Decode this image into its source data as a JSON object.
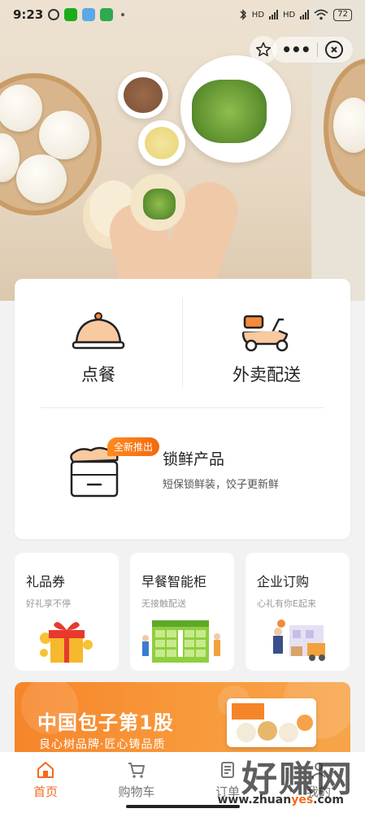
{
  "status_bar": {
    "time": "9:23",
    "battery": "72",
    "net1": "HD",
    "net2": "HD"
  },
  "hero": {
    "star_icon": "star-icon",
    "more_icon": "more-dots-icon",
    "close_icon": "close-circle-icon"
  },
  "services": {
    "dine": {
      "label": "点餐",
      "icon": "food-cloche-icon"
    },
    "delivery": {
      "label": "外卖配送",
      "icon": "scooter-icon"
    },
    "fresh": {
      "badge": "全新推出",
      "title": "锁鲜产品",
      "subtitle": "短保锁鲜装，饺子更新鲜",
      "icon": "fresh-box-icon"
    }
  },
  "tiles": [
    {
      "title": "礼品券",
      "subtitle": "好礼享不停",
      "icon": "gift-box-icon"
    },
    {
      "title": "早餐智能柜",
      "subtitle": "无接触配送",
      "icon": "smart-locker-icon"
    },
    {
      "title": "企业订购",
      "subtitle": "心礼有你E起来",
      "icon": "enterprise-order-icon"
    }
  ],
  "banner": {
    "title": "中国包子第1股",
    "subtitle": "良心树品牌·匠心铸品质"
  },
  "nav": [
    {
      "label": "首页",
      "icon": "home-icon",
      "active": true
    },
    {
      "label": "购物车",
      "icon": "cart-icon",
      "active": false
    },
    {
      "label": "订单",
      "icon": "order-icon",
      "active": false
    },
    {
      "label": "我的",
      "icon": "profile-icon",
      "active": false
    }
  ],
  "watermark": {
    "text": "好赚网",
    "url_pre": "www.zhuan",
    "url_hl": "yes",
    "url_post": ".com"
  },
  "colors": {
    "accent": "#f26b1d",
    "banner": "#f6852a",
    "background": "#f2f2f2"
  }
}
